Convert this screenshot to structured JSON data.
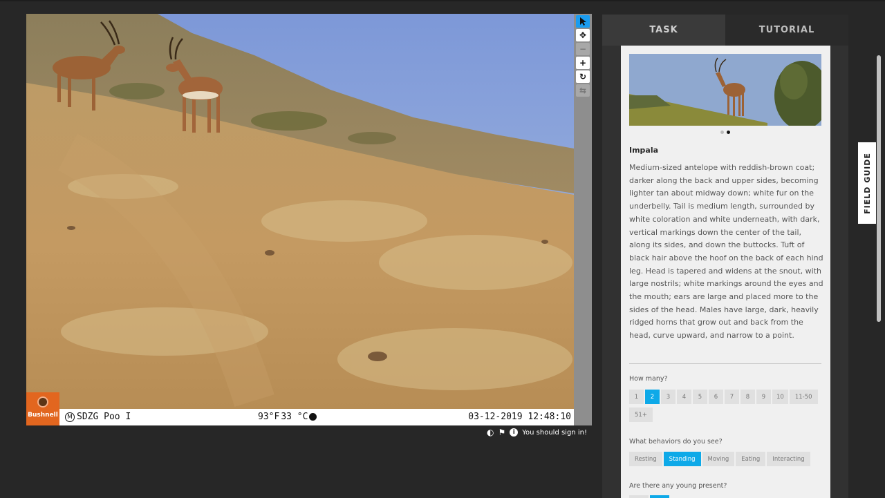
{
  "subject": {
    "camera": {
      "brand": "Bushnell",
      "mode_glyph": "M",
      "location": "SDZG Poo I",
      "temp_f": "93°F",
      "temp_c": "33 °C",
      "datetime": "03-12-2019 12:48:10"
    }
  },
  "toolbar": {
    "select_icon": "cursor-arrow-icon",
    "pan_icon": "move-arrows-icon",
    "zoom_out_icon": "minus-icon",
    "zoom_in_icon": "plus-icon",
    "rotate_icon": "rotate-icon",
    "reset_icon": "refresh-icon"
  },
  "meta": {
    "invert_icon": "half-circle-icon",
    "flag_icon": "flag-icon",
    "info_icon": "info-icon",
    "info_glyph": "i",
    "message": "You should sign in!"
  },
  "panel": {
    "tabs": [
      "TASK",
      "TUTORIAL"
    ],
    "species_name": "Impala",
    "description": "Medium-sized antelope with reddish-brown coat; darker along the back and upper sides, becoming lighter tan about midway down; white fur on the underbelly. Tail is medium length, surrounded by white coloration and white underneath, with dark, vertical markings down the center of the tail, along its sides, and down the buttocks. Tuft of black hair above the hoof on the back of each hind leg. Head is tapered and widens at the snout, with large nostrils; white markings around the eyes and the mouth; ears are large and placed more to the sides of the head. Males have large, dark, heavily ridged horns that grow out and back from the head, curve upward, and narrow to a point.",
    "carousel": {
      "count": 2,
      "active": 2
    },
    "questions": {
      "how_many": {
        "label": "How many?",
        "options": [
          "1",
          "2",
          "3",
          "4",
          "5",
          "6",
          "7",
          "8",
          "9",
          "10",
          "11-50",
          "51+"
        ],
        "selected": "2"
      },
      "behaviors": {
        "label": "What behaviors do you see?",
        "options": [
          "Resting",
          "Standing",
          "Moving",
          "Eating",
          "Interacting"
        ],
        "selected": "Standing"
      },
      "young": {
        "label": "Are there any young present?"
      }
    }
  },
  "field_guide": {
    "label": "FIELD GUIDE"
  },
  "colors": {
    "accent": "#0ea9e8",
    "toolbar_active": "#1a9cf0",
    "background": "#272727",
    "panel": "#f0f0f0"
  }
}
